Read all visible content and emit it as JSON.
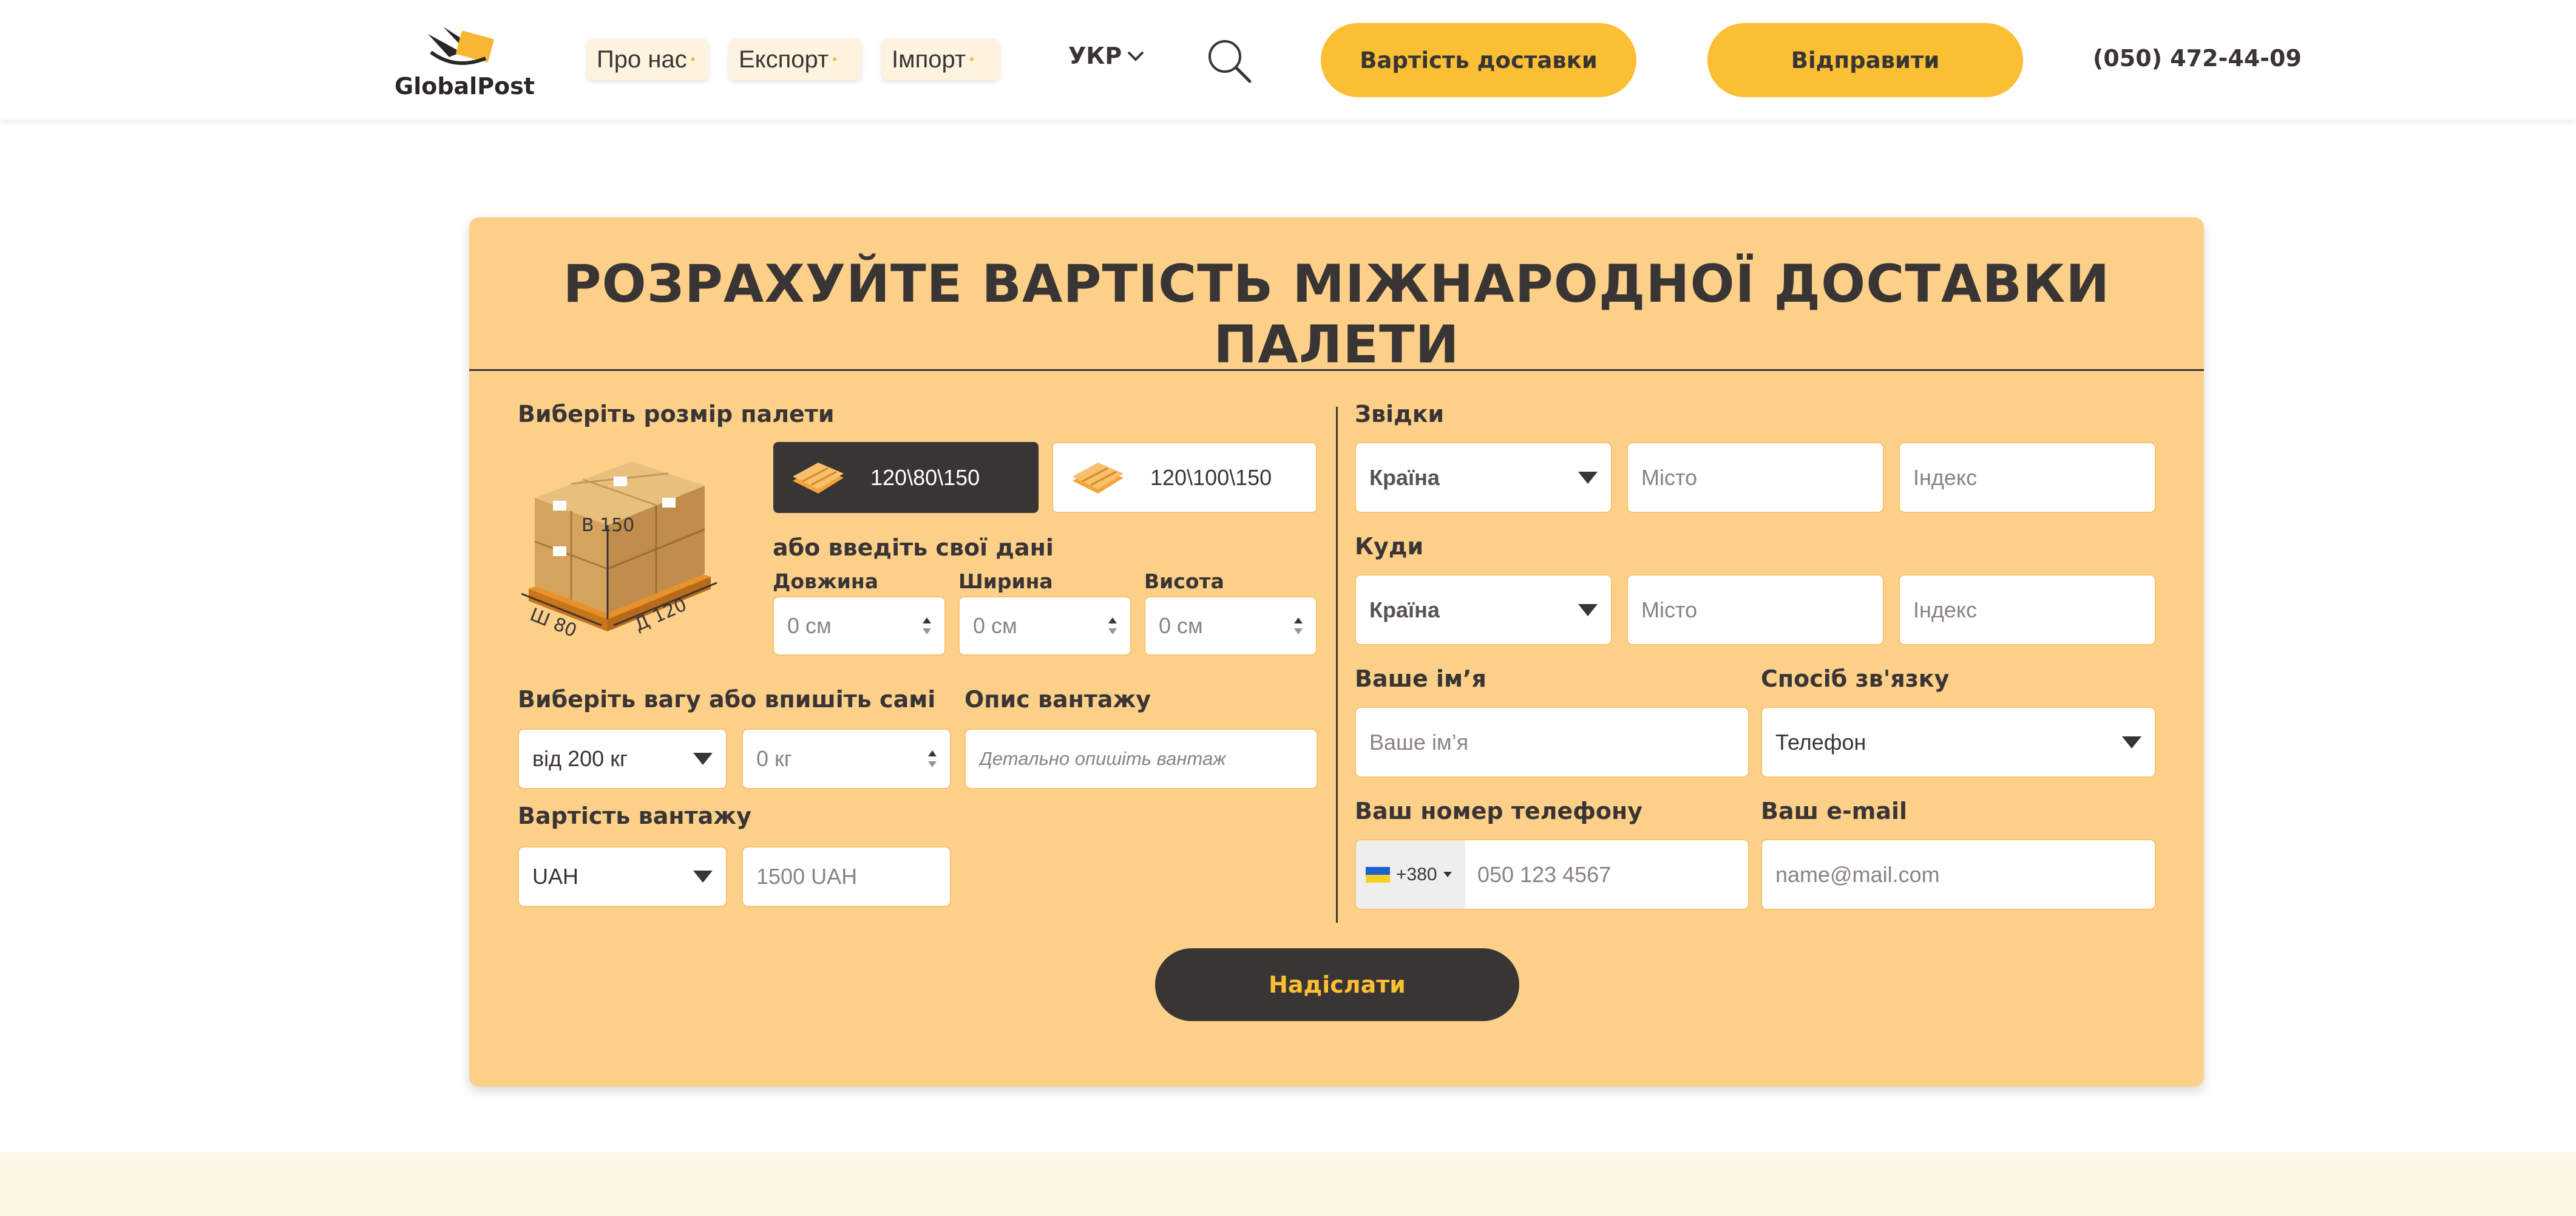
{
  "header": {
    "logo_text": "GlobalPost",
    "nav": [
      "Про нас",
      "Експорт",
      "Імпорт"
    ],
    "lang": "УКР",
    "cost_button": "Вартість доставки",
    "send_button": "Відправити",
    "phone": "(050) 472-44-09"
  },
  "form": {
    "title": "РОЗРАХУЙТЕ ВАРТІСТЬ МІЖНАРОДНОЇ ДОСТАВКИ ПАЛЕТИ",
    "pallet": {
      "label": "Виберіть розмір палети",
      "illus": {
        "h": "В 150",
        "w": "Ш 80",
        "d": "Д 120"
      },
      "options": [
        "120\\80\\150",
        "120\\100\\150"
      ],
      "selected": 0
    },
    "dims": {
      "label": "або введіть свої дані",
      "length_label": "Довжина",
      "width_label": "Ширина",
      "height_label": "Висота",
      "placeholder": "0 см"
    },
    "weight": {
      "label": "Виберіть вагу або впишіть самі",
      "select": "від 200 кг",
      "placeholder": "0 кг"
    },
    "desc": {
      "label": "Опис вантажу",
      "placeholder": "Детально опишіть вантаж"
    },
    "cargo_value": {
      "label": "Вартість вантажу",
      "currency": "UAH",
      "placeholder": "1500 UAH"
    },
    "from": {
      "label": "Звідки",
      "country": "Країна",
      "city": "Місто",
      "zip": "Індекс"
    },
    "to": {
      "label": "Куди",
      "country": "Країна",
      "city": "Місто",
      "zip": "Індекс"
    },
    "name": {
      "label": "Ваше ім’я",
      "placeholder": "Ваше ім’я"
    },
    "contact": {
      "label": "Спосіб зв'язку",
      "select": "Телефон"
    },
    "phone": {
      "label": "Ваш номер телефону",
      "prefix": "+380",
      "placeholder": "050 123 4567"
    },
    "email": {
      "label": "Ваш e-mail",
      "placeholder": "name@mail.com"
    },
    "submit": "Надіслати"
  },
  "colors": {
    "accent": "#fbbf33",
    "card": "#fdd08a",
    "dark": "#3a3535"
  }
}
